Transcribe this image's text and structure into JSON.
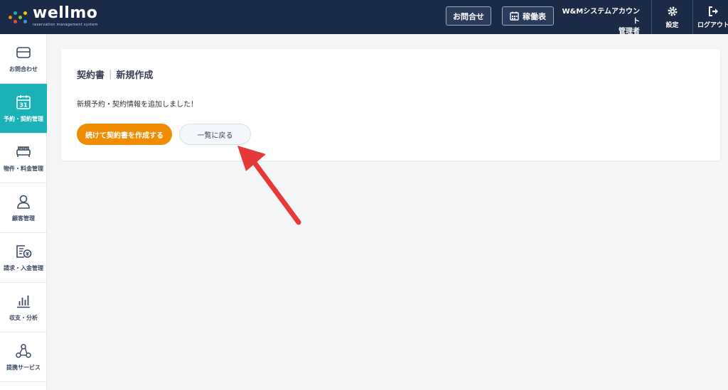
{
  "brand": {
    "name": "wellmo",
    "tagline": "reservation management system",
    "dot_colors": [
      "#f08c00",
      "#1bb2b7",
      "#e94e3c",
      "#8bc34a",
      "#f5c400",
      "#2e9ae0"
    ]
  },
  "header": {
    "contact_button": "お問合せ",
    "schedule_button": "稼働表",
    "account_line1": "W&Mシステムアカウント",
    "account_line2": "管理者",
    "settings_label": "設定",
    "logout_label": "ログアウト"
  },
  "sidebar": {
    "items": [
      {
        "label": "お問合わせ",
        "icon": "mail-icon",
        "active": false
      },
      {
        "label": "予約・契約管理",
        "icon": "calendar-icon",
        "calendar_day": "31",
        "active": true
      },
      {
        "label": "物件・料金管理",
        "icon": "bed-icon",
        "active": false
      },
      {
        "label": "顧客管理",
        "icon": "user-icon",
        "active": false
      },
      {
        "label": "請求・入金管理",
        "icon": "invoice-yen-icon",
        "active": false
      },
      {
        "label": "収支・分析",
        "icon": "bar-chart-icon",
        "active": false
      },
      {
        "label": "提携サービス",
        "icon": "network-icon",
        "active": false
      }
    ]
  },
  "main": {
    "title_main": "契約書",
    "title_sep": "|",
    "title_sub": "新規作成",
    "message": "新規予約・契約情報を追加しました！",
    "primary_button": "続けて契約書を作成する",
    "secondary_button": "一覧に戻る"
  },
  "colors": {
    "header_bg": "#1a2a47",
    "accent_teal": "#1bb2b7",
    "accent_orange": "#f08c00",
    "arrow_red": "#e8393a"
  }
}
